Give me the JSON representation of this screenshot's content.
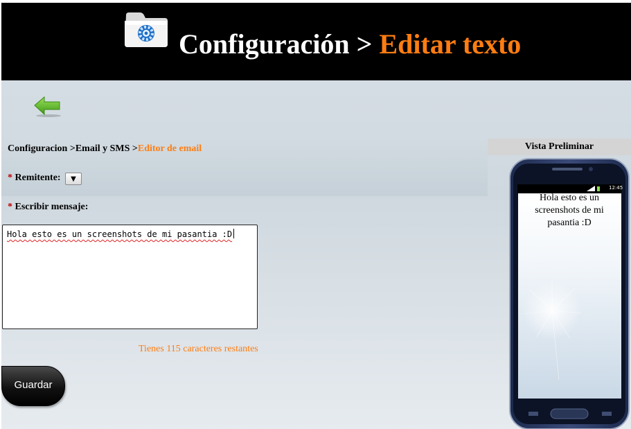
{
  "header": {
    "title_main": "Configuración >",
    "title_accent": "Editar texto",
    "icon": "folder-gear-icon"
  },
  "nav": {
    "back_icon": "back-arrow-icon"
  },
  "breadcrumb": {
    "part1": "Configuracion >",
    "part2": "Email y SMS >",
    "current": "Editor de email"
  },
  "form": {
    "required_mark": "*",
    "remitente_label": "Remitente:",
    "remitente_select_glyph": "▼",
    "mensaje_label": "Escribir mensaje:",
    "mensaje_value": "Hola esto es un screenshots de mi pasantia :D",
    "counter_text": "Tienes 115 caracteres restantes",
    "save_label": "Guardar"
  },
  "preview": {
    "title": "Vista Preliminar",
    "status_time": "12:45",
    "message": "Hola esto es un screenshots de mi pasantia :D"
  },
  "colors": {
    "accent": "#ff7d12",
    "header_bg": "#000000",
    "required": "#c00000"
  }
}
